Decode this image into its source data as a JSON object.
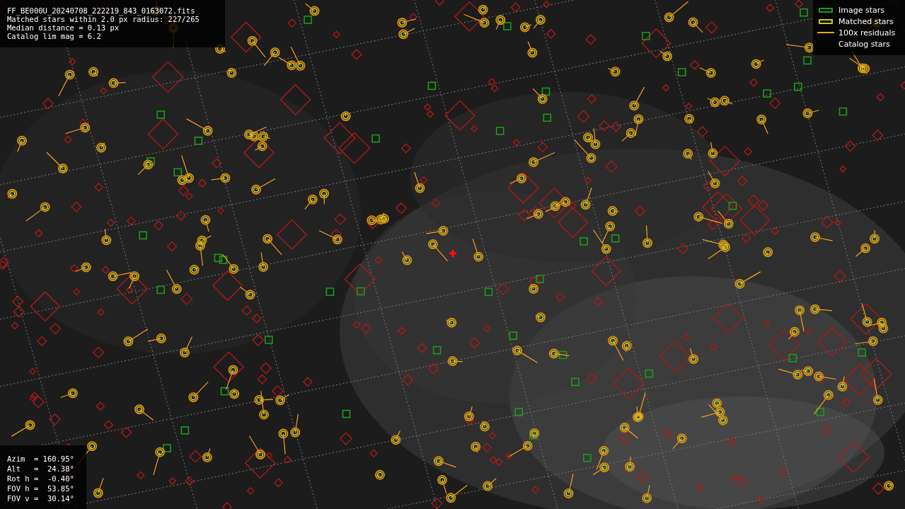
{
  "info": {
    "lines": [
      "FF_BE000U_20240708_222219_843_0163072.fits",
      "Matched stars within 2.0 px radius: 227/265",
      "Median distance = 0.13 px",
      "Catalog lim mag = 6.2"
    ]
  },
  "legend": [
    {
      "label": "Image stars"
    },
    {
      "kind": "matched",
      "label": "Matched stars"
    },
    {
      "kind": "residual",
      "label": "100x residuals"
    },
    {
      "kind": "catalog",
      "label": "Catalog stars"
    }
  ],
  "pointing": {
    "lines": [
      "Azim  = 160.95°",
      "Alt   =  24.38°",
      "Rot h =  -0.40°",
      "FOV h =  53.85°",
      "FOV v =  30.14°"
    ]
  }
}
